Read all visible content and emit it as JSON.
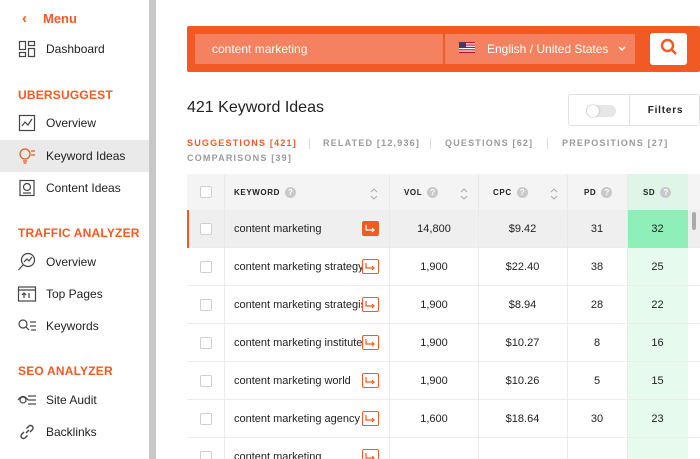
{
  "sidebar": {
    "back_icon": "chevron-left-icon",
    "menu_label": "Menu",
    "dashboard": {
      "label": "Dashboard",
      "icon": "dashboard-icon"
    },
    "sections": [
      {
        "title": "UBERSUGGEST",
        "items": [
          {
            "label": "Overview",
            "icon": "overview-chart-icon"
          },
          {
            "label": "Keyword Ideas",
            "icon": "lightbulb-icon",
            "active": true
          },
          {
            "label": "Content Ideas",
            "icon": "content-icon"
          }
        ]
      },
      {
        "title": "TRAFFIC ANALYZER",
        "items": [
          {
            "label": "Overview",
            "icon": "magnifier-chart-icon"
          },
          {
            "label": "Top Pages",
            "icon": "top-pages-icon"
          },
          {
            "label": "Keywords",
            "icon": "keywords-icon"
          }
        ]
      },
      {
        "title": "SEO ANALYZER",
        "items": [
          {
            "label": "Site Audit",
            "icon": "site-audit-icon"
          },
          {
            "label": "Backlinks",
            "icon": "link-icon"
          }
        ]
      }
    ]
  },
  "search": {
    "query": "content marketing",
    "language": "English / United States",
    "flag_icon": "us-flag-icon",
    "search_icon": "search-icon"
  },
  "results": {
    "title": "421 Keyword Ideas",
    "filters_label": "Filters"
  },
  "tabs": [
    {
      "label": "SUGGESTIONS [421]",
      "active": true
    },
    {
      "label": "RELATED [12,936]"
    },
    {
      "label": "QUESTIONS [62]"
    },
    {
      "label": "PREPOSITIONS [27]"
    },
    {
      "label": "COMPARISONS [39]"
    }
  ],
  "table": {
    "columns": {
      "keyword": "KEYWORD",
      "vol": "VOL",
      "cpc": "CPC",
      "pd": "PD",
      "sd": "SD"
    },
    "help_glyph": "?",
    "rows": [
      {
        "keyword": "content marketing",
        "vol": "14,800",
        "cpc": "$9.42",
        "pd": "31",
        "sd": "32"
      },
      {
        "keyword": "content marketing strategy",
        "vol": "1,900",
        "cpc": "$22.40",
        "pd": "38",
        "sd": "25"
      },
      {
        "keyword": "content marketing strategist",
        "vol": "1,900",
        "cpc": "$8.94",
        "pd": "28",
        "sd": "22"
      },
      {
        "keyword": "content marketing institute",
        "vol": "1,900",
        "cpc": "$10.27",
        "pd": "8",
        "sd": "16"
      },
      {
        "keyword": "content marketing world",
        "vol": "1,900",
        "cpc": "$10.26",
        "pd": "5",
        "sd": "15"
      },
      {
        "keyword": "content marketing agency",
        "vol": "1,600",
        "cpc": "$18.64",
        "pd": "30",
        "sd": "23"
      },
      {
        "keyword": "content marketing",
        "vol": "",
        "cpc": "",
        "pd": "",
        "sd": ""
      }
    ]
  },
  "colors": {
    "accent": "#f15a24",
    "sd_highlight": "#8ef0b8",
    "sd_column": "#e6faee"
  }
}
